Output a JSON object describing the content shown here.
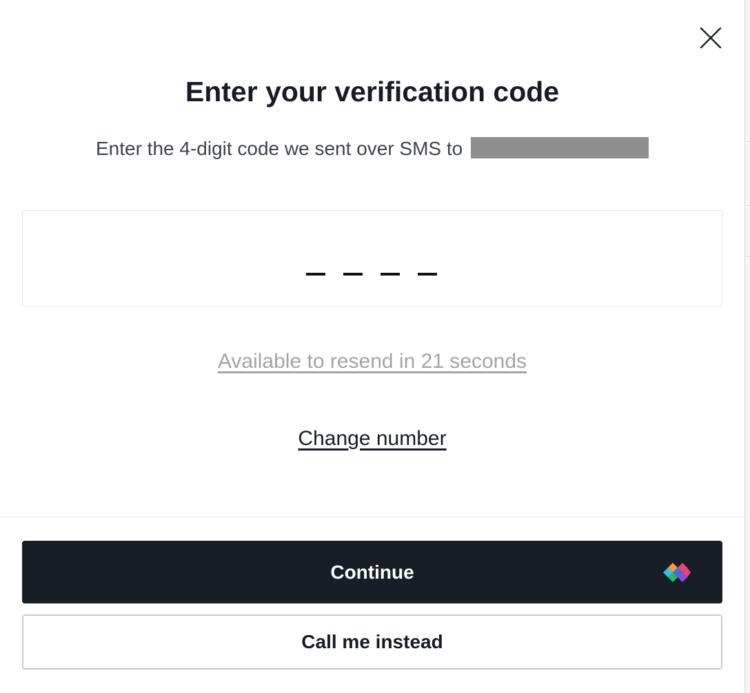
{
  "modal": {
    "title": "Enter your verification code",
    "subtitle": "Enter the 4-digit code we sent over SMS to",
    "phone_number": "",
    "code": {
      "length": 4,
      "value": ""
    },
    "resend_text": "Available to resend in 21 seconds",
    "change_number_label": "Change number",
    "continue_label": "Continue",
    "call_label": "Call me instead",
    "close_icon": "close-icon",
    "brand_icon": "diamond-logo-icon"
  },
  "colors": {
    "primary_button": "#181e28",
    "title_text": "#161b26",
    "muted_text": "#a1a4ab",
    "redaction": "#8e8e8e",
    "brand_cyan": "#2fc3e6",
    "brand_blue": "#3b6fe0",
    "brand_green": "#2eb86b",
    "brand_orange": "#f39c3a",
    "brand_pink": "#e8457a",
    "brand_purple": "#8b4de0"
  }
}
